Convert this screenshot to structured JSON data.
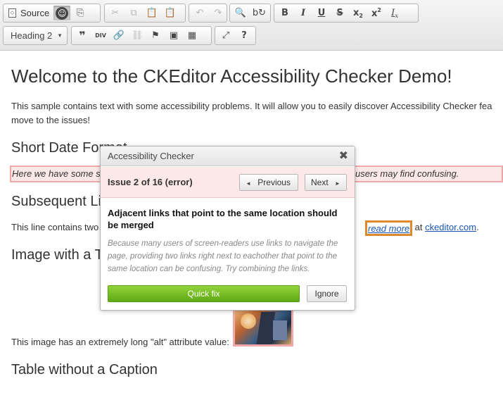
{
  "toolbar": {
    "source_label": "Source",
    "bold": "B",
    "italic": "I",
    "underline": "U",
    "strike": "S",
    "subscript_main": "x",
    "subscript_mark": "2",
    "superscript_main": "x",
    "superscript_mark": "2",
    "remove_format_main": "I",
    "remove_format_mark": "x",
    "format_combo": "Heading 2",
    "help": "?",
    "accent_color": "#e0882c"
  },
  "document": {
    "title": "Welcome to the CKEditor Accessibility Checker Demo!",
    "intro_line1": "This sample contains text with some accessibility problems. It will allow you to easily discover Accessibility Checker fea",
    "intro_line2": "move to the issues!",
    "h_short_date": "Short Date Format",
    "short_date_left": "Here we have some s",
    "short_date_right": "users may find confusing.",
    "h_links": "Subsequent Li",
    "links_text": "This line contains two",
    "read_more": "read more",
    "at_text": " at ",
    "ckeditor_link": "ckeditor.com",
    "period": ".",
    "h_image": "Image with a T",
    "image_text": "This image has an extremely long \"alt\" attribute value:",
    "h_table": "Table without a Caption",
    "issue_highlight_color": "#f2a8a8"
  },
  "dialog": {
    "title": "Accessibility Checker",
    "close": "✖",
    "issue_label": "Issue 2 of 16 (error)",
    "previous_label": "Previous",
    "next_label": "Next",
    "issue_heading": "Adjacent links that point to the same location should be merged",
    "issue_description": "Because many users of screen-readers use links to navigate the page, providing two links right next to eachother that point to the same location can be confusing. Try combining the links.",
    "quick_fix_label": "Quick fix",
    "ignore_label": "Ignore",
    "quick_fix_color": "#6cbc1f"
  }
}
